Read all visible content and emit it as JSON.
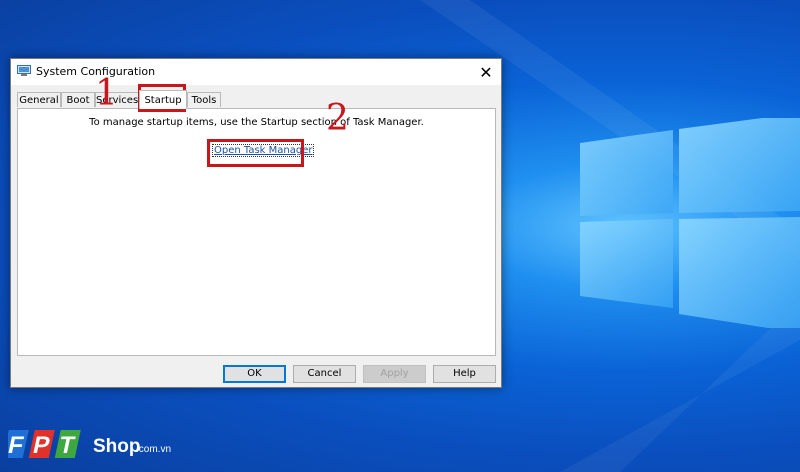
{
  "window": {
    "title": "System Configuration",
    "close_glyph": "✕",
    "title_icon": "msconfig-icon"
  },
  "tabs": [
    {
      "label": "General"
    },
    {
      "label": "Boot"
    },
    {
      "label": "Services"
    },
    {
      "label": "Startup",
      "active": true
    },
    {
      "label": "Tools"
    }
  ],
  "panel": {
    "message": "To manage startup items, use the Startup section of Task Manager.",
    "link_label": "Open Task Manager"
  },
  "buttons": {
    "ok": "OK",
    "cancel": "Cancel",
    "apply": "Apply",
    "help": "Help"
  },
  "annotations": {
    "step1": "1",
    "step2": "2",
    "color": "#c8161d"
  },
  "watermark": {
    "brand": "FPT",
    "shop": "Shop",
    "domain": ".com.vn"
  },
  "colors": {
    "desktop": "#0a63d6",
    "link": "#1a52a6",
    "focus": "#0078d7"
  }
}
